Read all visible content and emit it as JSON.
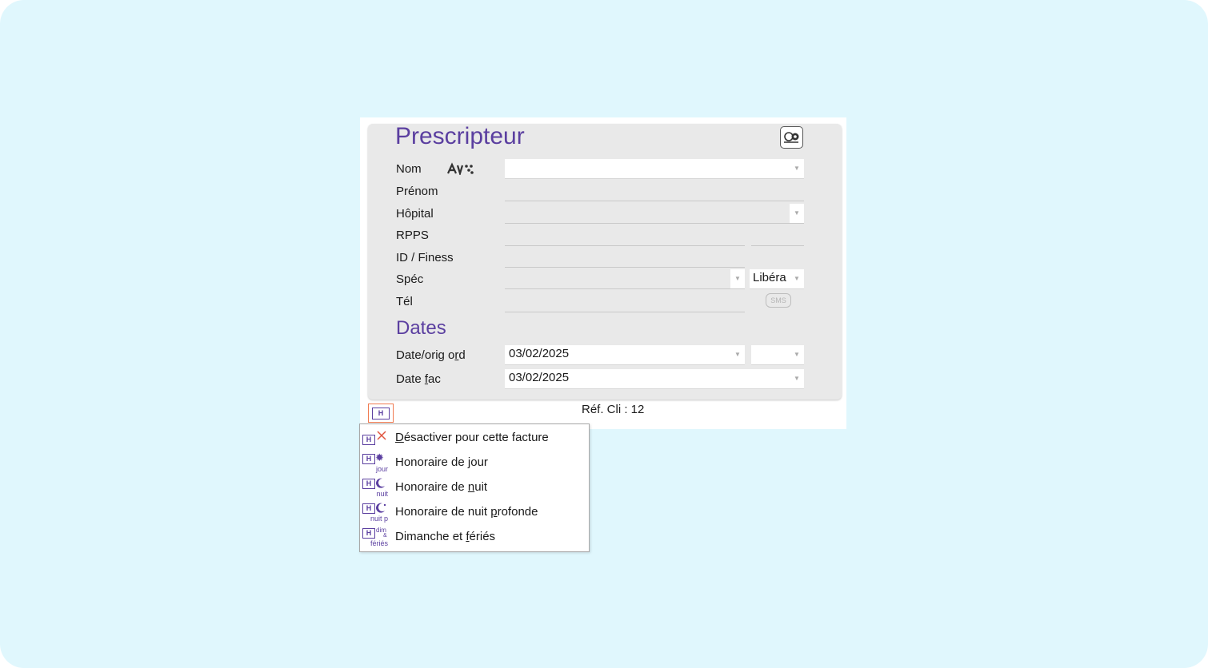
{
  "section_title": "Prescripteur",
  "fields": {
    "nom": "Nom",
    "prenom": "Prénom",
    "hopital": "Hôpital",
    "rpps": "RPPS",
    "id_finess": "ID / Finess",
    "spec": "Spéc",
    "tel": "Tél"
  },
  "spec_mode": "Libéra",
  "sms_label": "SMS",
  "dates_title": "Dates",
  "dates": {
    "date_orig_label_pre": "Date/orig o",
    "date_orig_label_ul": "r",
    "date_orig_label_post": "d",
    "date_orig_value": "03/02/2025",
    "date_fac_label_pre": "Date ",
    "date_fac_label_ul": "f",
    "date_fac_label_post": "ac",
    "date_fac_value": "03/02/2025"
  },
  "ref_cli": "Réf. Cli : 12",
  "h_button": "H",
  "menu": {
    "items": [
      {
        "pre": "",
        "ul": "D",
        "post": "ésactiver pour cette facture",
        "icon_sub": ""
      },
      {
        "pre": "Honoraire de ",
        "ul": "j",
        "post": "our",
        "icon_sub": "jour"
      },
      {
        "pre": "Honoraire de ",
        "ul": "n",
        "post": "uit",
        "icon_sub": "nuit"
      },
      {
        "pre": "Honoraire de nuit ",
        "ul": "p",
        "post": "rofonde",
        "icon_sub": "nuit p"
      },
      {
        "pre": "Dimanche et ",
        "ul": "f",
        "post": "ériés",
        "icon_sub": "fériés"
      }
    ]
  },
  "colors": {
    "accent": "#5b3fa0",
    "highlight": "#f07a50",
    "background": "#e0f7fd"
  }
}
